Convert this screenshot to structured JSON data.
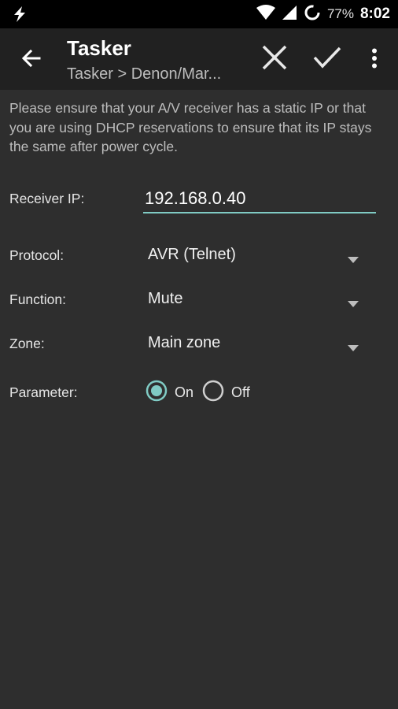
{
  "status_bar": {
    "battery_percent": "77%",
    "time": "8:02",
    "colors": {
      "background": "#000000"
    }
  },
  "toolbar": {
    "title": "Tasker",
    "subtitle": "Tasker > Denon/Mar...",
    "back_icon": "arrow-left-icon",
    "cancel_icon": "close-icon",
    "confirm_icon": "check-icon",
    "more_icon": "more-vertical-icon"
  },
  "info_text": "Please ensure that your A/V receiver has a static IP or that you are using DHCP reservations to ensure that its IP stays the same after power cycle.",
  "form": {
    "receiver_ip": {
      "label": "Receiver IP:",
      "value": "192.168.0.40"
    },
    "protocol": {
      "label": "Protocol:",
      "value": "AVR (Telnet)"
    },
    "function": {
      "label": "Function:",
      "value": "Mute"
    },
    "zone": {
      "label": "Zone:",
      "value": "Main zone"
    },
    "parameter": {
      "label": "Parameter:",
      "options": [
        {
          "label": "On",
          "selected": true
        },
        {
          "label": "Off",
          "selected": false
        }
      ]
    }
  },
  "colors": {
    "accent": "#80cbc4",
    "background": "#2e2e2e",
    "toolbar": "#212121"
  }
}
